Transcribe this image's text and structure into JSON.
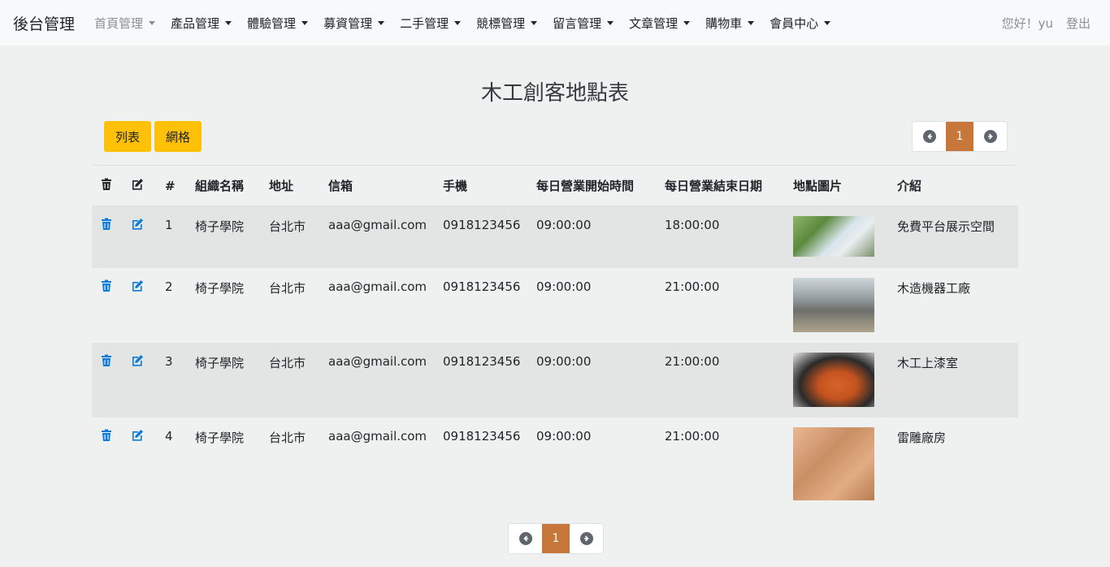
{
  "navbar": {
    "brand": "後台管理",
    "items": [
      {
        "label": "首頁管理",
        "muted": true
      },
      {
        "label": "產品管理"
      },
      {
        "label": "體驗管理"
      },
      {
        "label": "募資管理"
      },
      {
        "label": "二手管理"
      },
      {
        "label": "競標管理"
      },
      {
        "label": "留言管理"
      },
      {
        "label": "文章管理"
      },
      {
        "label": "購物車"
      },
      {
        "label": "會員中心"
      }
    ],
    "greeting": "您好！yu",
    "logout": "登出"
  },
  "page": {
    "title": "木工創客地點表",
    "list_button": "列表",
    "grid_button": "網格",
    "current_page": "1"
  },
  "table": {
    "headers": {
      "num": "#",
      "name": "組織名稱",
      "address": "地址",
      "email": "信箱",
      "phone": "手機",
      "open": "每日營業開始時間",
      "close": "每日營業結束日期",
      "image": "地點圖片",
      "intro": "介紹"
    },
    "rows": [
      {
        "num": "1",
        "name": "椅子學院",
        "address": "台北市",
        "email": "aaa@gmail.com",
        "phone": "0918123456",
        "open": "09:00:00",
        "close": "18:00:00",
        "intro": "免費平台展示空間"
      },
      {
        "num": "2",
        "name": "椅子學院",
        "address": "台北市",
        "email": "aaa@gmail.com",
        "phone": "0918123456",
        "open": "09:00:00",
        "close": "21:00:00",
        "intro": "木造機器工廠"
      },
      {
        "num": "3",
        "name": "椅子學院",
        "address": "台北市",
        "email": "aaa@gmail.com",
        "phone": "0918123456",
        "open": "09:00:00",
        "close": "21:00:00",
        "intro": "木工上漆室"
      },
      {
        "num": "4",
        "name": "椅子學院",
        "address": "台北市",
        "email": "aaa@gmail.com",
        "phone": "0918123456",
        "open": "09:00:00",
        "close": "21:00:00",
        "intro": "雷雕廠房"
      }
    ]
  },
  "colors": {
    "accent_yellow": "#ffc107",
    "active_page": "#c8773a",
    "icon_blue": "#0d7bd9"
  }
}
